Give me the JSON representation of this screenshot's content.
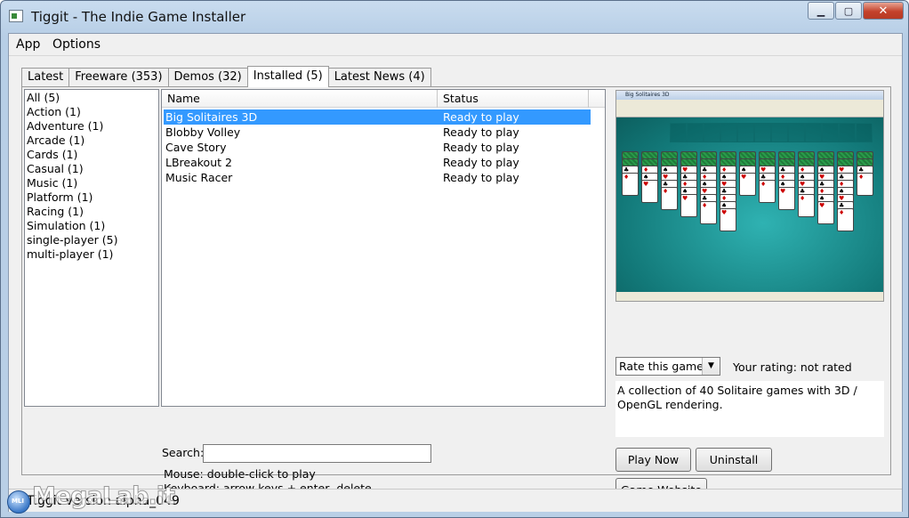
{
  "window": {
    "title": "Tiggit - The Indie Game Installer",
    "min_symbol": "▁",
    "max_symbol": "▢",
    "close_symbol": "✕"
  },
  "menu": {
    "app": "App",
    "options": "Options"
  },
  "tabs": [
    {
      "label": "Latest",
      "active": false
    },
    {
      "label": "Freeware (353)",
      "active": false
    },
    {
      "label": "Demos (32)",
      "active": false
    },
    {
      "label": "Installed (5)",
      "active": true
    },
    {
      "label": "Latest News (4)",
      "active": false
    }
  ],
  "categories": [
    "All (5)",
    "Action (1)",
    "Adventure (1)",
    "Arcade (1)",
    "Cards (1)",
    "Casual (1)",
    "Music (1)",
    "Platform (1)",
    "Racing (1)",
    "Simulation (1)",
    "single-player (5)",
    "multi-player (1)"
  ],
  "gamelist": {
    "columns": {
      "name": "Name",
      "status": "Status"
    },
    "rows": [
      {
        "name": "Big Solitaires 3D",
        "status": "Ready to play",
        "selected": true
      },
      {
        "name": "Blobby Volley",
        "status": "Ready to play",
        "selected": false
      },
      {
        "name": "Cave Story",
        "status": "Ready to play",
        "selected": false
      },
      {
        "name": "LBreakout 2",
        "status": "Ready to play",
        "selected": false
      },
      {
        "name": "Music Racer",
        "status": "Ready to play",
        "selected": false
      }
    ]
  },
  "preview": {
    "window_title": "Big Solitaires 3D"
  },
  "rating": {
    "select_value": "Rate this game",
    "your_rating": "Your rating: not rated"
  },
  "description": "A collection of 40 Solitaire games with 3D / OpenGL rendering.",
  "search": {
    "label": "Search:",
    "value": ""
  },
  "hints": {
    "mouse": "Mouse: double-click to play",
    "keyboard": "Keyboard: arrow keys + enter, delete"
  },
  "buttons": {
    "play": "Play Now",
    "uninstall": "Uninstall",
    "website": "Game Website"
  },
  "statusbar": {
    "text": "Tiggit version alpha_049"
  },
  "watermark": {
    "brand": "MegaLab.it",
    "badge": "MLI"
  },
  "colors": {
    "selection": "#3399ff",
    "close_button": "#c4422c"
  }
}
